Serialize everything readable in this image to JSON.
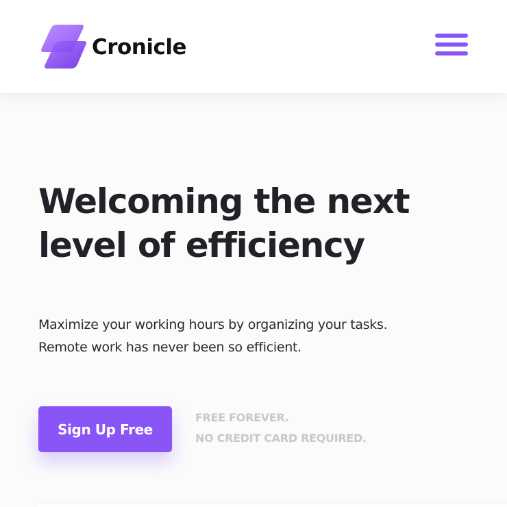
{
  "brand": {
    "name": "Cronicle",
    "logo_icon": "cronicle-logo-icon",
    "accent_color": "#8a55f7"
  },
  "header": {
    "menu_icon": "hamburger-menu-icon"
  },
  "hero": {
    "title_line_1": "Welcoming the next",
    "title_line_2": "level of efficiency",
    "subtitle_line_1": "Maximize your working hours by organizing your tasks.",
    "subtitle_line_2": "Remote work has never been so efficient."
  },
  "cta": {
    "button_label": "Sign Up Free",
    "note_line_1": "FREE FOREVER.",
    "note_line_2": "NO CREDIT CARD REQUIRED."
  }
}
